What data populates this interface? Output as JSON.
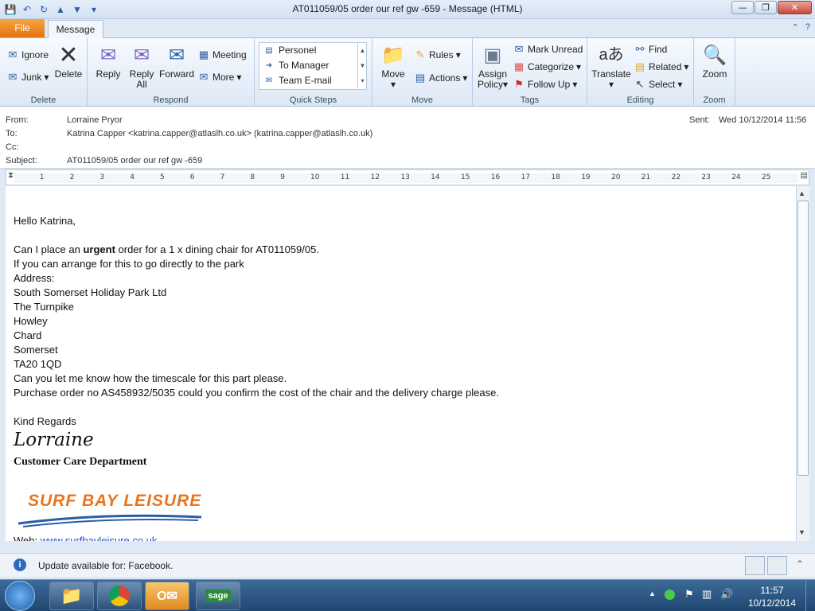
{
  "window": {
    "title": "AT011059/05 order our ref  gw -659 - Message (HTML)"
  },
  "tabs": {
    "file": "File",
    "message": "Message"
  },
  "ribbon": {
    "delete_group": {
      "label": "Delete",
      "ignore": "Ignore",
      "junk": "Junk",
      "delete": "Delete"
    },
    "respond_group": {
      "label": "Respond",
      "reply": "Reply",
      "reply_all_1": "Reply",
      "reply_all_2": "All",
      "forward": "Forward",
      "meeting": "Meeting",
      "more": "More"
    },
    "quick_steps": {
      "label": "Quick Steps",
      "items": [
        "Personel",
        "To Manager",
        "Team E-mail"
      ]
    },
    "move_group": {
      "label": "Move",
      "move": "Move",
      "rules": "Rules",
      "actions": "Actions"
    },
    "tags_group": {
      "label": "Tags",
      "assign_1": "Assign",
      "assign_2": "Policy",
      "mark_unread": "Mark Unread",
      "categorize": "Categorize",
      "follow_up": "Follow Up"
    },
    "editing_group": {
      "label": "Editing",
      "translate": "Translate",
      "find": "Find",
      "related": "Related",
      "select": "Select"
    },
    "zoom_group": {
      "label": "Zoom",
      "zoom": "Zoom"
    }
  },
  "headers": {
    "from_label": "From:",
    "from": "Lorraine Pryor",
    "to_label": "To:",
    "to": "Katrina Capper <katrina.capper@atlaslh.co.uk> (katrina.capper@atlaslh.co.uk)",
    "cc_label": "Cc:",
    "subject_label": "Subject:",
    "subject": "AT011059/05 order our ref  gw -659",
    "sent_label": "Sent:",
    "sent": "Wed 10/12/2014 11:56"
  },
  "ruler_marks": [
    "1",
    "2",
    "3",
    "4",
    "5",
    "6",
    "7",
    "8",
    "9",
    "10",
    "11",
    "12",
    "13",
    "14",
    "15",
    "16",
    "17",
    "18",
    "19",
    "20",
    "21",
    "22",
    "23",
    "24",
    "25"
  ],
  "body": {
    "greeting": "Hello Katrina,",
    "l1_pre": "Can I place an ",
    "l1_bold": "urgent",
    "l1_post": " order for a 1 x dining chair for AT011059/05.",
    "l2": "If you can arrange for this to go directly to the park",
    "l3": "Address:",
    "l4": "South Somerset Holiday Park Ltd",
    "l5": "The Turnpike",
    "l6": "Howley",
    "l7": "Chard",
    "l8": "Somerset",
    "l9": "TA20 1QD",
    "l10": "Can you let me know how the timescale for this part please.",
    "l11": "Purchase order no AS458932/5035 could you confirm the cost of the chair and the delivery charge please.",
    "regards": "Kind Regards",
    "signature": "Lorraine",
    "department": "Customer Care Department",
    "logo": "SURF BAY LEISURE",
    "web_label": "Web: ",
    "web_url": "www.surfbayleisure.co.uk"
  },
  "infobar": {
    "text": "Update available for: Facebook."
  },
  "taskbar": {
    "time": "11:57",
    "date": "10/12/2014",
    "sage": "sage"
  },
  "colors": {
    "accent": "#e2720d",
    "ribbon": "#dfe9f5",
    "taskbar": "#1f4770",
    "logo": "#e8741e"
  }
}
